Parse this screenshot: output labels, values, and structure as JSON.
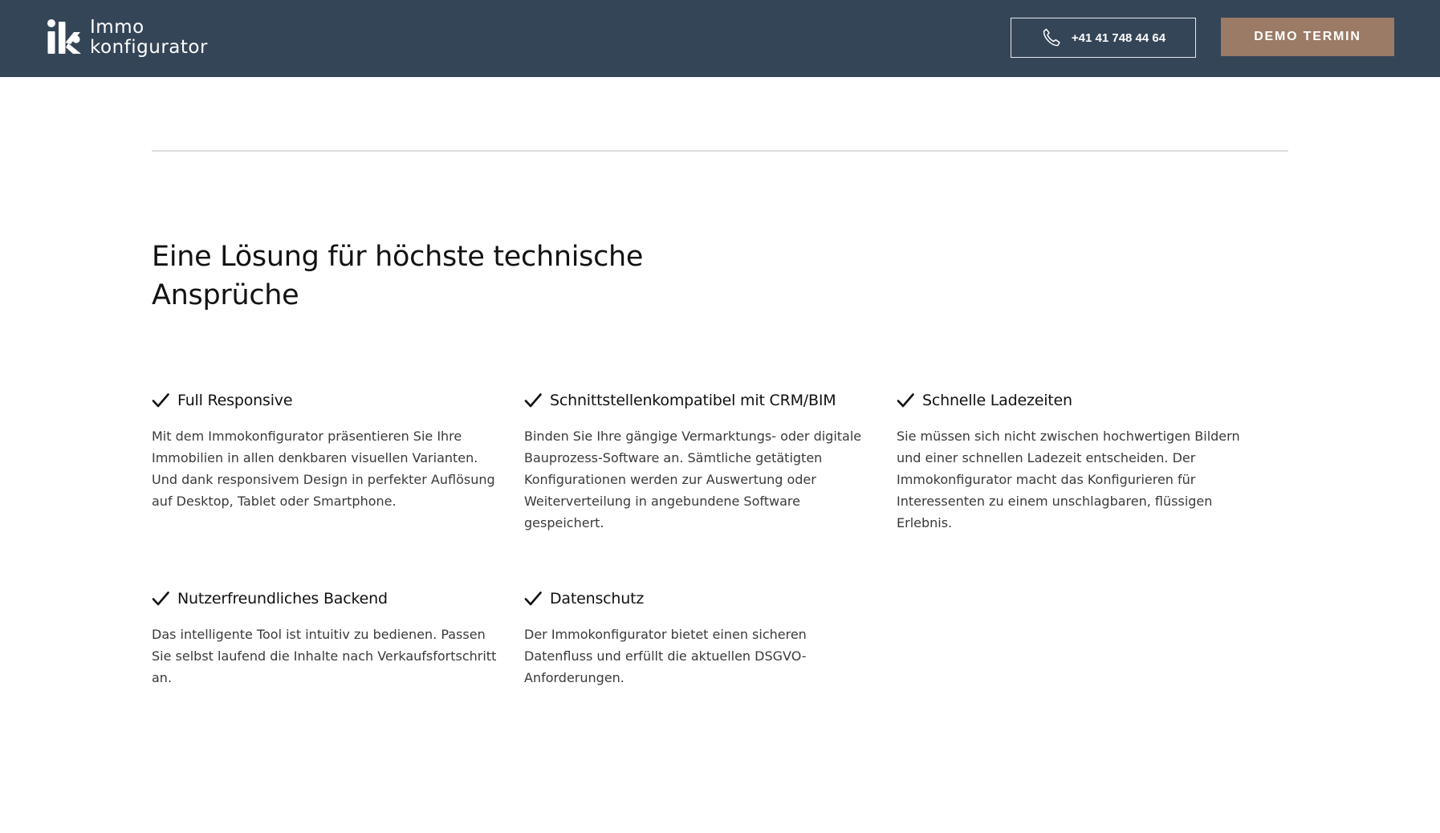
{
  "header": {
    "logo": {
      "line1": "Immo",
      "line2": "konfigurator"
    },
    "phone_label": "+41 41 748 44 64",
    "demo_label": "DEMO TERMIN",
    "background_color": "#344557",
    "accent_color": "#9b7a66"
  },
  "section": {
    "title": "Eine Lösung für höchste technische Ansprüche"
  },
  "features": [
    {
      "icon": "check-icon",
      "title": "Full Responsive",
      "text": "Mit dem Immokonfigurator präsentieren Sie Ihre Immobilien in allen denkbaren visuellen Varianten. Und dank responsivem Design in perfekter Auflösung auf Desktop, Tablet oder Smartphone."
    },
    {
      "icon": "check-icon",
      "title": "Schnittstellenkompatibel mit CRM/BIM",
      "text": "Binden Sie Ihre gängige Vermarktungs- oder digitale Bauprozess-Software an. Sämtliche getätigten Konfigurationen werden zur Auswertung oder Weiterverteilung in angebundene Software gespeichert."
    },
    {
      "icon": "check-icon",
      "title": "Schnelle Ladezeiten",
      "text": "Sie müssen sich nicht zwischen hochwertigen Bildern und einer schnellen Ladezeit entscheiden. Der Immokonfigurator macht das Konfigurieren für Interessenten zu einem unschlagbaren, flüssigen Erlebnis."
    },
    {
      "icon": "check-icon",
      "title": "Nutzerfreundliches Backend",
      "text": "Das intelligente Tool ist intuitiv zu bedienen. Passen Sie selbst laufend die Inhalte nach Verkaufsfortschritt an."
    },
    {
      "icon": "check-icon",
      "title": "Datenschutz",
      "text": "Der Immokonfigurator bietet einen sicheren Datenfluss und erfüllt die aktuellen DSGVO-Anforderungen."
    }
  ]
}
